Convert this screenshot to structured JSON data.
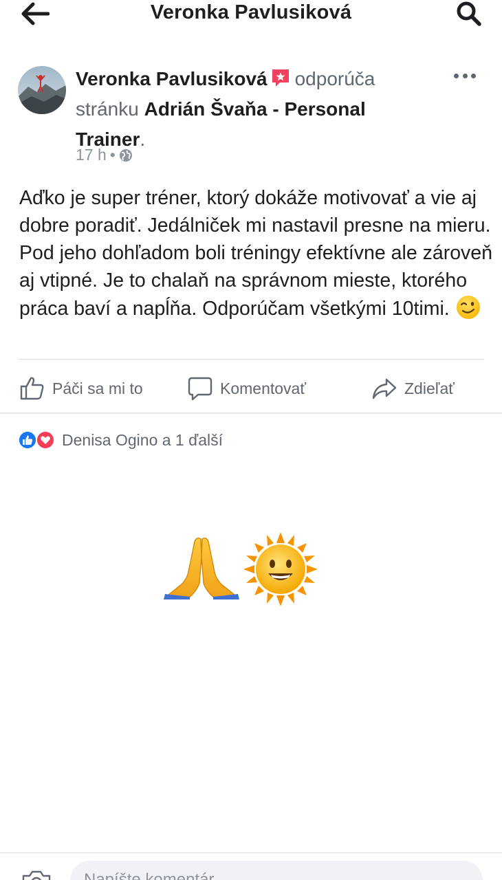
{
  "header": {
    "title": "Veronka Pavlusiková",
    "back_icon": "arrow-left-icon",
    "search_icon": "search-icon"
  },
  "post": {
    "author": "Veronka Pavlusiková",
    "action_text": "odporúča",
    "page_prefix": "stránku",
    "page_name": "Adrián Švaňa - Personal Trainer",
    "page_suffix": ".",
    "timestamp": "17 h",
    "audience_icon": "globe-icon",
    "text": "Aďko je super tréner, ktorý dokáže motivovať a vie aj dobre poradiť. Jedálniček mi nastavil presne na mieru. Pod jeho dohľadom boli tréningy efektívne ale zároveň aj vtipné. Je to chalaň na správnom mieste, ktorého práca baví a napĺňa. Odporúčam všetkými 10timi.",
    "emoji": "winking-face"
  },
  "actions": {
    "like_label": "Páči sa mi to",
    "comment_label": "Komentovať",
    "share_label": "Zdieľať"
  },
  "reactions": {
    "summary": "Denisa Ogino a 1 ďalší",
    "types": [
      "like",
      "love"
    ]
  },
  "comment": {
    "emojis": [
      "folded-hands",
      "sun-with-face"
    ]
  },
  "composer": {
    "placeholder": "Napíšte komentár..."
  },
  "colors": {
    "brand_blue": "#1877f2",
    "love_red": "#f33e58",
    "recommend_badge": "#f3425f",
    "secondary_text": "#606770"
  }
}
